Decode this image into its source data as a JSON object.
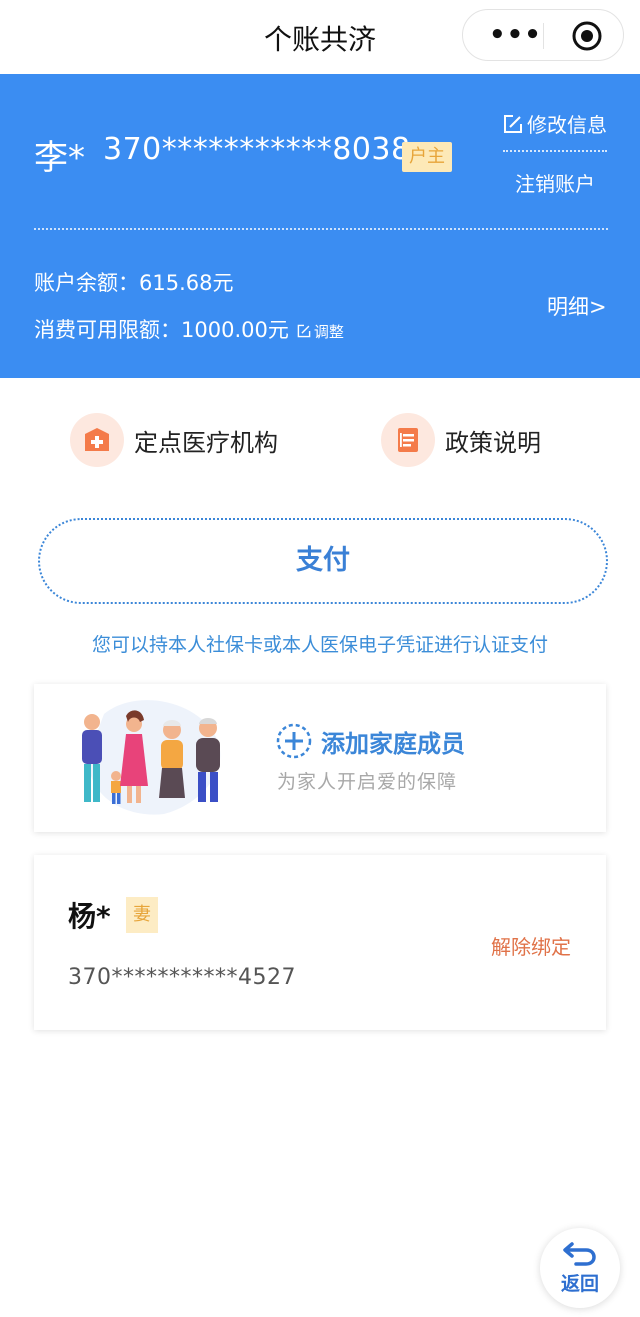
{
  "nav": {
    "title": "个账共济",
    "more_icon": "more-dots-icon",
    "close_icon": "target-circle-icon"
  },
  "account": {
    "name": "李*",
    "id_number": "370***********8038",
    "role": "户主",
    "edit_label": "修改信息",
    "cancel_label": "注销账户",
    "balance_text": "账户余额：615.68元",
    "limit_text": "消费可用限额：1000.00元",
    "adjust_label": "调整",
    "detail_label": "明细>",
    "color": "#3b8df2"
  },
  "quick_entries": [
    {
      "label": "定点医疗机构",
      "icon": "medical-kit-icon"
    },
    {
      "label": "政策说明",
      "icon": "document-icon"
    }
  ],
  "pay": {
    "label": "支付",
    "hint": "您可以持本人社保卡或本人医保电子凭证进行认证支付"
  },
  "add_family": {
    "title": "添加家庭成员",
    "subtitle": "为家人开启爱的保障",
    "illustration": "family-illustration"
  },
  "members": [
    {
      "name": "杨*",
      "relation": "妻",
      "id_number": "370***********4527",
      "action": "解除绑定"
    }
  ],
  "back": {
    "label": "返回",
    "icon": "return-arrow-icon"
  }
}
